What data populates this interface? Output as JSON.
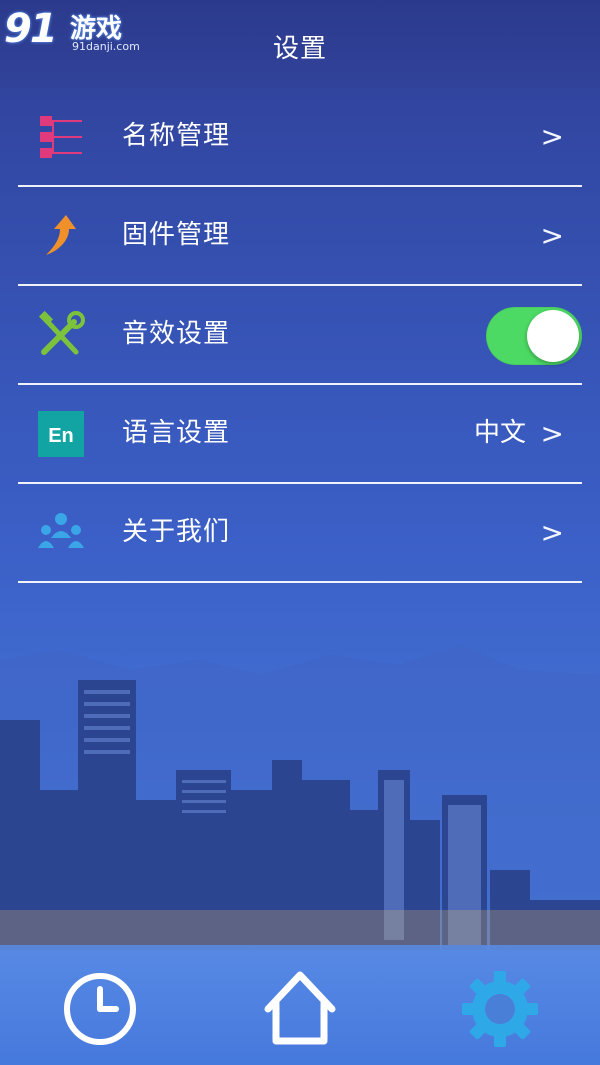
{
  "watermark": {
    "number": "91",
    "brand": "游戏",
    "url": "91danji.com"
  },
  "header": {
    "title": "设置"
  },
  "menu": [
    {
      "label": "名称管理",
      "icon": "list-icon",
      "chevron": ">"
    },
    {
      "label": "固件管理",
      "icon": "upgrade-arrow-icon",
      "chevron": ">"
    },
    {
      "label": "音效设置",
      "icon": "tools-icon",
      "toggle_on": true
    },
    {
      "label": "语言设置",
      "icon": "language-en-icon",
      "icon_text": "En",
      "value": "中文",
      "chevron": ">"
    },
    {
      "label": "关于我们",
      "icon": "people-icon",
      "chevron": ">"
    }
  ],
  "tabbar": {
    "items": [
      {
        "icon": "clock-icon"
      },
      {
        "icon": "home-icon"
      },
      {
        "icon": "gear-icon",
        "active": true
      }
    ]
  },
  "colors": {
    "background_top": "#2f3f96",
    "background_bottom": "#4a83e0",
    "toggle_on": "#4cd964",
    "active_tab": "#2fa8e8"
  }
}
